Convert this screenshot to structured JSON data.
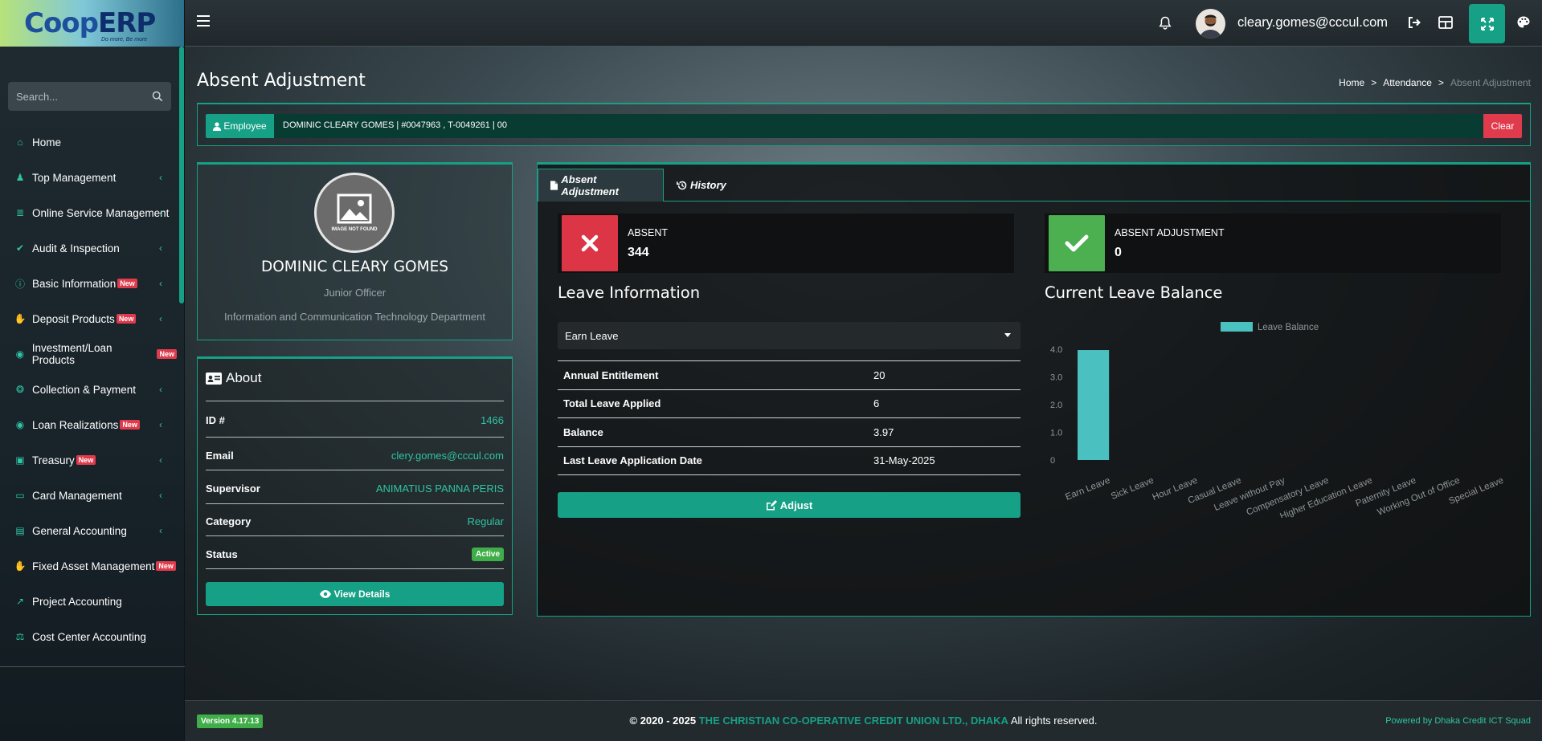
{
  "app": {
    "logo_coop": "Coop",
    "logo_erp": "ERP",
    "logo_tagline": "Do more, Be more",
    "search_placeholder": "Search..."
  },
  "sidebar": {
    "items": [
      {
        "label": "Home",
        "icon": "home-icon",
        "chevron": false,
        "new": false
      },
      {
        "label": "Top Management",
        "icon": "user-tie-icon",
        "chevron": true,
        "new": false
      },
      {
        "label": "Online Service Management",
        "icon": "database-icon",
        "chevron": true,
        "new": false
      },
      {
        "label": "Audit & Inspection",
        "icon": "clipboard-check-icon",
        "chevron": true,
        "new": false
      },
      {
        "label": "Basic Information",
        "icon": "info-circle-icon",
        "chevron": true,
        "new": true
      },
      {
        "label": "Deposit Products",
        "icon": "hand-coin-icon",
        "chevron": true,
        "new": true
      },
      {
        "label": "Investment/Loan Products",
        "icon": "coin-user-icon",
        "chevron": false,
        "new": true
      },
      {
        "label": "Collection & Payment",
        "icon": "coins-icon",
        "chevron": true,
        "new": false
      },
      {
        "label": "Loan Realizations",
        "icon": "coin-user-icon",
        "chevron": true,
        "new": true
      },
      {
        "label": "Treasury",
        "icon": "toolbox-icon",
        "chevron": true,
        "new": true
      },
      {
        "label": "Card Management",
        "icon": "credit-card-icon",
        "chevron": true,
        "new": false
      },
      {
        "label": "General Accounting",
        "icon": "book-icon",
        "chevron": true,
        "new": false
      },
      {
        "label": "Fixed Asset Management",
        "icon": "money-hand-icon",
        "chevron": false,
        "new": true
      },
      {
        "label": "Project Accounting",
        "icon": "chart-line-icon",
        "chevron": false,
        "new": false
      },
      {
        "label": "Cost Center Accounting",
        "icon": "balance-scale-icon",
        "chevron": false,
        "new": false
      }
    ],
    "new_badge": "New"
  },
  "topbar": {
    "user_email": "cleary.gomes@cccul.com"
  },
  "page": {
    "title": "Absent Adjustment",
    "breadcrumb": [
      "Home",
      "Attendance",
      "Absent Adjustment"
    ]
  },
  "employee_bar": {
    "label": "Employee",
    "value": "DOMINIC CLEARY GOMES | #0047963 , T-0049261 | 00",
    "clear_label": "Clear"
  },
  "profile": {
    "image_alt": "IMAGE NOT FOUND",
    "name": "DOMINIC CLEARY GOMES",
    "role": "Junior Officer",
    "department": "Information and Communication Technology Department"
  },
  "about": {
    "title": "About",
    "rows": [
      {
        "key": "ID #",
        "value": "1466"
      },
      {
        "key": "Email",
        "value": "clery.gomes@cccul.com"
      },
      {
        "key": "Supervisor",
        "value": "ANIMATIUS PANNA PERIS"
      },
      {
        "key": "Category",
        "value": "Regular"
      },
      {
        "key": "Status",
        "value": "Active"
      }
    ],
    "view_details_label": "View Details"
  },
  "main": {
    "tabs": [
      {
        "label": "Absent Adjustment",
        "active": true
      },
      {
        "label": "History",
        "active": false
      }
    ],
    "absent": {
      "label": "ABSENT",
      "value": "344",
      "color": "#dc3545"
    },
    "absent_adjustment": {
      "label": "ABSENT ADJUSTMENT",
      "value": "0",
      "color": "#4caf50"
    },
    "leave_info_title": "Leave Information",
    "leave_type_selected": "Earn Leave",
    "leave_table": [
      {
        "key": "Annual Entitlement",
        "value": "20"
      },
      {
        "key": "Total Leave Applied",
        "value": "6"
      },
      {
        "key": "Balance",
        "value": "3.97"
      },
      {
        "key": "Last Leave Application Date",
        "value": "31-May-2025"
      }
    ],
    "adjust_label": "Adjust",
    "balance_title": "Current Leave Balance"
  },
  "chart_data": {
    "type": "bar",
    "categories": [
      "Earn Leave",
      "Sick  Leave",
      "Hour Leave",
      "Casual Leave",
      "Leave without Pay",
      "Compensatory Leave",
      "Higher Education Leave",
      "Paternity Leave",
      "Working Out of Office",
      "Special Leave"
    ],
    "series": [
      {
        "name": "Leave Balance",
        "values": [
          3.97,
          0,
          0,
          0,
          0,
          0,
          0,
          0,
          0,
          0
        ],
        "color": "#4bc0c0"
      }
    ],
    "ylim": [
      0,
      4
    ],
    "yticks": [
      "0",
      "1.0",
      "2.0",
      "3.0",
      "4.0"
    ],
    "legend": "top"
  },
  "footer": {
    "version": "Version 4.17.13",
    "copyright_prefix": "© 2020 - 2025",
    "org": "THE CHRISTIAN CO-OPERATIVE CREDIT UNION LTD., DHAKA",
    "rights": "All rights reserved.",
    "powered": "Powered by Dhaka Credit ICT Squad"
  },
  "colors": {
    "accent": "#16a085",
    "danger": "#dc3545",
    "success": "#4caf50"
  }
}
